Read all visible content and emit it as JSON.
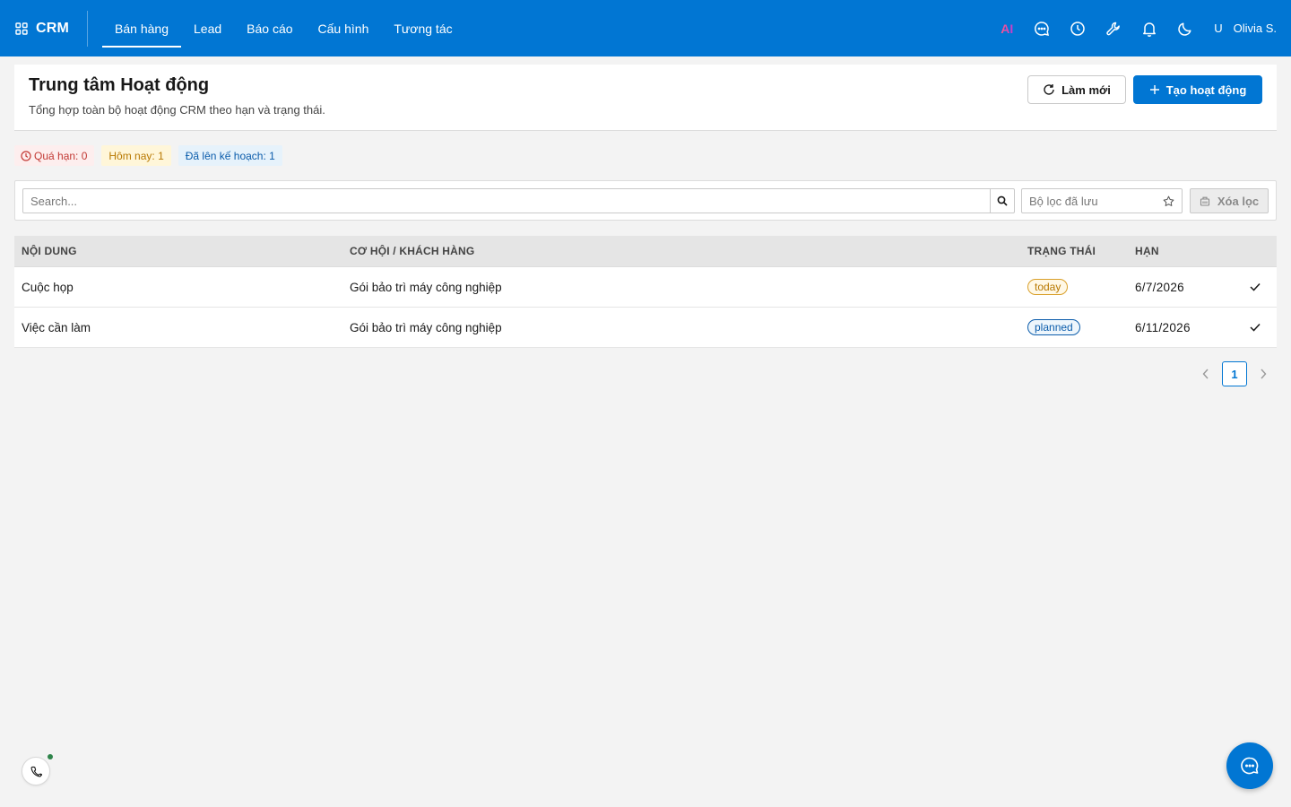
{
  "app": {
    "name": "CRM"
  },
  "nav": {
    "items": [
      {
        "label": "Bán hàng",
        "active": true
      },
      {
        "label": "Lead"
      },
      {
        "label": "Báo cáo"
      },
      {
        "label": "Cấu hình"
      },
      {
        "label": "Tương tác"
      }
    ]
  },
  "topbar": {
    "ai_label": "AI",
    "icons": [
      "chat-icon",
      "history-icon",
      "wrench-icon",
      "bell-icon",
      "moon-icon"
    ],
    "user_initial": "U",
    "user_name": "Olivia S."
  },
  "header": {
    "title": "Trung tâm Hoạt động",
    "subtitle": "Tổng hợp toàn bộ hoạt động CRM theo hạn và trạng thái.",
    "refresh_label": "Làm mới",
    "create_label": "Tạo hoạt động"
  },
  "chips": {
    "overdue": "Quá hạn: 0",
    "today": "Hôm nay: 1",
    "planned": "Đã lên kế hoạch: 1"
  },
  "filters": {
    "search_placeholder": "Search...",
    "saved_filter_placeholder": "Bộ lọc đã lưu",
    "clear_label": "Xóa lọc"
  },
  "table": {
    "columns": [
      "NỘI DUNG",
      "CƠ HỘI / KHÁCH HÀNG",
      "TRẠNG THÁI",
      "HẠN"
    ],
    "rows": [
      {
        "content": "Cuộc họp",
        "opportunity": "Gói bảo trì máy công nghiệp",
        "status": "today",
        "due": "6/7/2026"
      },
      {
        "content": "Việc cần làm",
        "opportunity": "Gói bảo trì máy công nghiệp",
        "status": "planned",
        "due": "6/11/2026"
      }
    ]
  },
  "pagination": {
    "current_page": "1"
  },
  "colors": {
    "brand": "#0176d3",
    "overdue": "#c23934",
    "today": "#b87800",
    "planned": "#0b5cab",
    "online": "#2e844a"
  }
}
